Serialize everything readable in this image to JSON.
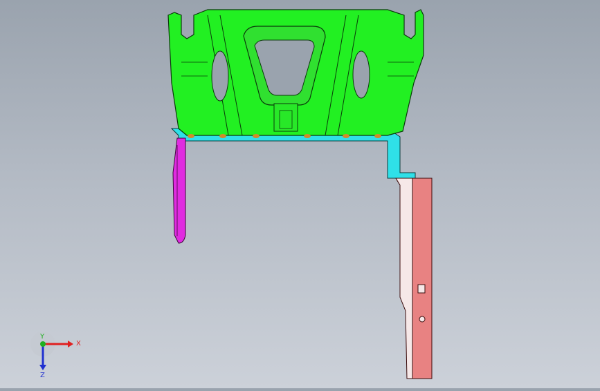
{
  "scene": {
    "parts": [
      {
        "name": "bracket-body",
        "color": "#22f022"
      },
      {
        "name": "base-flange",
        "color": "#2fe0e8"
      },
      {
        "name": "left-tab",
        "color": "#e02be0"
      },
      {
        "name": "right-bracket",
        "color": "#e88282"
      },
      {
        "name": "weld-points",
        "color": "#d28a2a"
      }
    ],
    "edge_color": "#0a3a0a"
  },
  "triad": {
    "x_label": "X",
    "y_label": "Y",
    "z_label": "Z",
    "x_color": "#e02020",
    "y_color": "#20b020",
    "z_color": "#2030d0"
  }
}
